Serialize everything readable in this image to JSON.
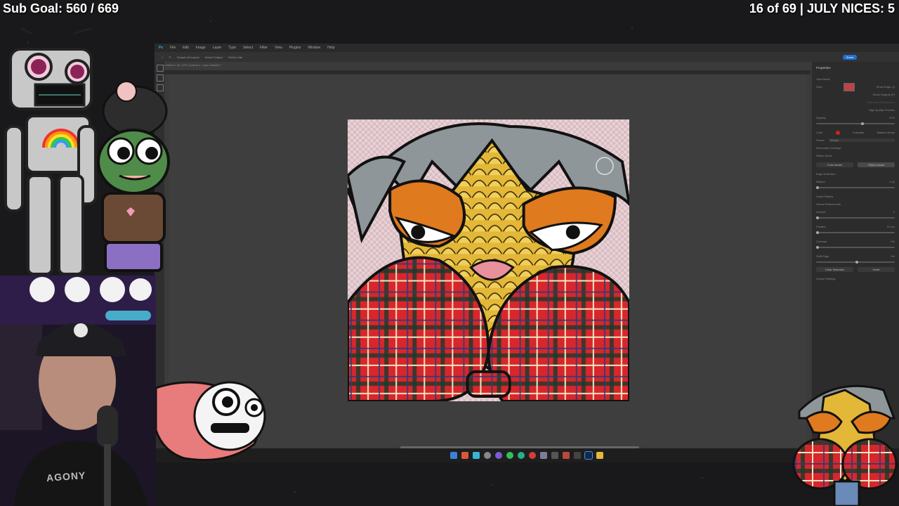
{
  "overlay": {
    "sub_goal": "Sub Goal: 560 / 669",
    "counter": "16 of 69 | JULY NICES: 5"
  },
  "photoshop": {
    "menu": [
      "File",
      "Edit",
      "Image",
      "Layer",
      "Type",
      "Select",
      "Filter",
      "View",
      "Plugins",
      "Window",
      "Help"
    ],
    "options": [
      "Sample All Layers",
      "Select Subject",
      "Refine Hair"
    ],
    "share_label": "Share",
    "doc_tab": "Untitled-1 @ 113% (mabny 2, Layer Mask/8) *",
    "panel": {
      "title": "Properties",
      "view_mode_label": "View Mode",
      "view_label": "View",
      "show_edge": "Show Edge (J)",
      "show_original": "Show Original (P)",
      "real_time": "Real-time Refinement",
      "hq_preview": "High Quality Preview",
      "opacity_label": "Opacity",
      "opacity_value": "57%",
      "color_label": "Color",
      "indicates_label": "Indicates",
      "indicates_value": "Masked Areas",
      "preset_label": "Preset",
      "preset_value": "Default",
      "remember_settings": "Remember Settings",
      "refine_mode": "Refine Mode",
      "color_aware": "Color Aware",
      "object_aware": "Object Aware",
      "edge_detection": "Edge Detection",
      "radius_label": "Radius",
      "radius_value": "0 px",
      "smart_radius": "Smart Radius",
      "global_refinements": "Global Refinements",
      "smooth_label": "Smooth",
      "smooth_value": "0",
      "feather_label": "Feather",
      "feather_value": "0.0 px",
      "contrast_label": "Contrast",
      "contrast_value": "0%",
      "shift_edge_label": "Shift Edge",
      "shift_edge_value": "0%",
      "clear_selection": "Clear Selection",
      "invert": "Invert",
      "output_settings": "Output Settings"
    }
  },
  "webcam": {
    "shirt_text": "AGONY"
  },
  "colors": {
    "accent": "#1f6fd1",
    "plaid_red": "#d8262c",
    "corn_yellow": "#e3b737",
    "hair_gray": "#8f9699",
    "eye_orange": "#e07a1e"
  }
}
